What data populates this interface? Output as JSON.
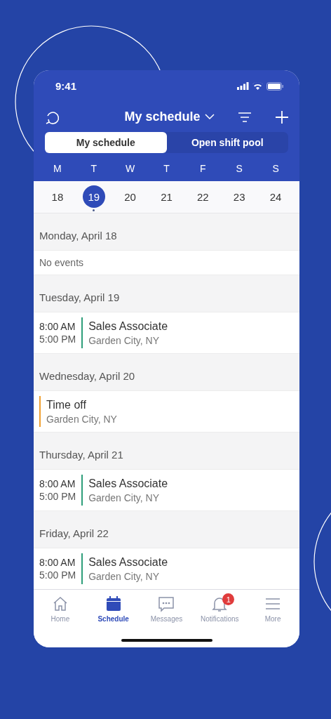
{
  "status_bar": {
    "time": "9:41"
  },
  "header": {
    "title": "My schedule"
  },
  "segments": [
    {
      "label": "My schedule",
      "selected": true
    },
    {
      "label": "Open shift pool",
      "selected": false
    }
  ],
  "week": [
    {
      "weekday": "M",
      "date": "18",
      "selected": false,
      "has_events": false
    },
    {
      "weekday": "T",
      "date": "19",
      "selected": true,
      "has_events": true
    },
    {
      "weekday": "W",
      "date": "20",
      "selected": false,
      "has_events": false
    },
    {
      "weekday": "T",
      "date": "21",
      "selected": false,
      "has_events": false
    },
    {
      "weekday": "F",
      "date": "22",
      "selected": false,
      "has_events": false
    },
    {
      "weekday": "S",
      "date": "23",
      "selected": false,
      "has_events": false
    },
    {
      "weekday": "S",
      "date": "24",
      "selected": false,
      "has_events": false
    }
  ],
  "days": [
    {
      "heading": "Monday, April 18",
      "events": [
        {
          "kind": "empty",
          "text": "No events"
        }
      ]
    },
    {
      "heading": "Tuesday, April 19",
      "events": [
        {
          "kind": "shift",
          "start": "8:00 AM",
          "end": "5:00 PM",
          "title": "Sales Associate",
          "location": "Garden City, NY",
          "color": "#2e9e7a"
        }
      ]
    },
    {
      "heading": "Wednesday, April 20",
      "events": [
        {
          "kind": "time_off",
          "title": "Time off",
          "location": "Garden City, NY",
          "color": "#f0a030"
        }
      ]
    },
    {
      "heading": "Thursday, April 21",
      "events": [
        {
          "kind": "shift",
          "start": "8:00 AM",
          "end": "5:00 PM",
          "title": "Sales Associate",
          "location": "Garden City, NY",
          "color": "#2e9e7a"
        }
      ]
    },
    {
      "heading": "Friday, April 22",
      "events": [
        {
          "kind": "shift",
          "start": "8:00 AM",
          "end": "5:00 PM",
          "title": "Sales Associate",
          "location": "Garden City, NY",
          "color": "#2e9e7a"
        }
      ]
    }
  ],
  "nav": [
    {
      "kind": "home",
      "label": "Home",
      "selected": false
    },
    {
      "kind": "schedule",
      "label": "Schedule",
      "selected": true
    },
    {
      "kind": "messages",
      "label": "Messages",
      "selected": false
    },
    {
      "kind": "notifications",
      "label": "Notifications",
      "selected": false,
      "badge": "1"
    },
    {
      "kind": "more",
      "label": "More",
      "selected": false
    }
  ]
}
